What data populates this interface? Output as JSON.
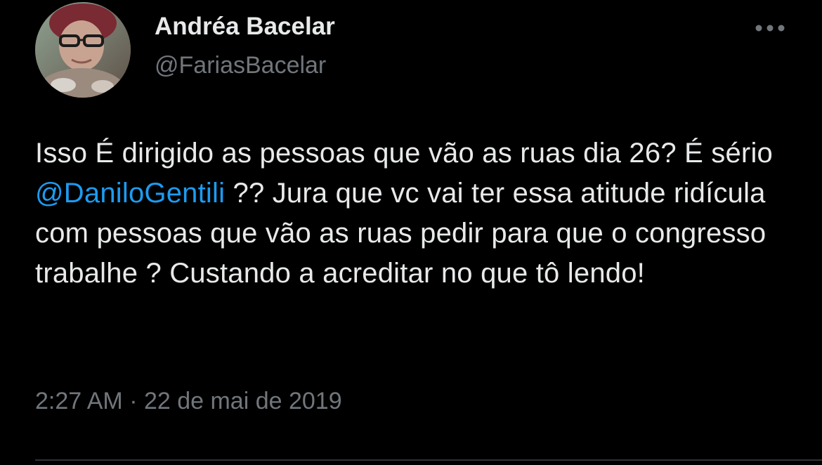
{
  "author": {
    "display_name": "Andréa Bacelar",
    "handle": "@FariasBacelar"
  },
  "menu": {
    "icon": "more-horizontal-icon"
  },
  "tweet": {
    "text_before_mention": "Isso É dirigido as pessoas que vão as ruas dia 26? É sério ",
    "mention": "@DaniloGentili",
    "text_after_mention": " ?? Jura que vc vai ter essa atitude ridícula com pessoas que vão as ruas pedir para que o congresso trabalhe ? Custando a acreditar no que tô lendo!",
    "timestamp": "2:27 AM · 22 de mai de 2019"
  },
  "colors": {
    "background": "#000000",
    "primary_text": "#e7e9ea",
    "secondary_text": "#71767b",
    "link": "#1d9bf0",
    "divider": "#2f3336"
  }
}
